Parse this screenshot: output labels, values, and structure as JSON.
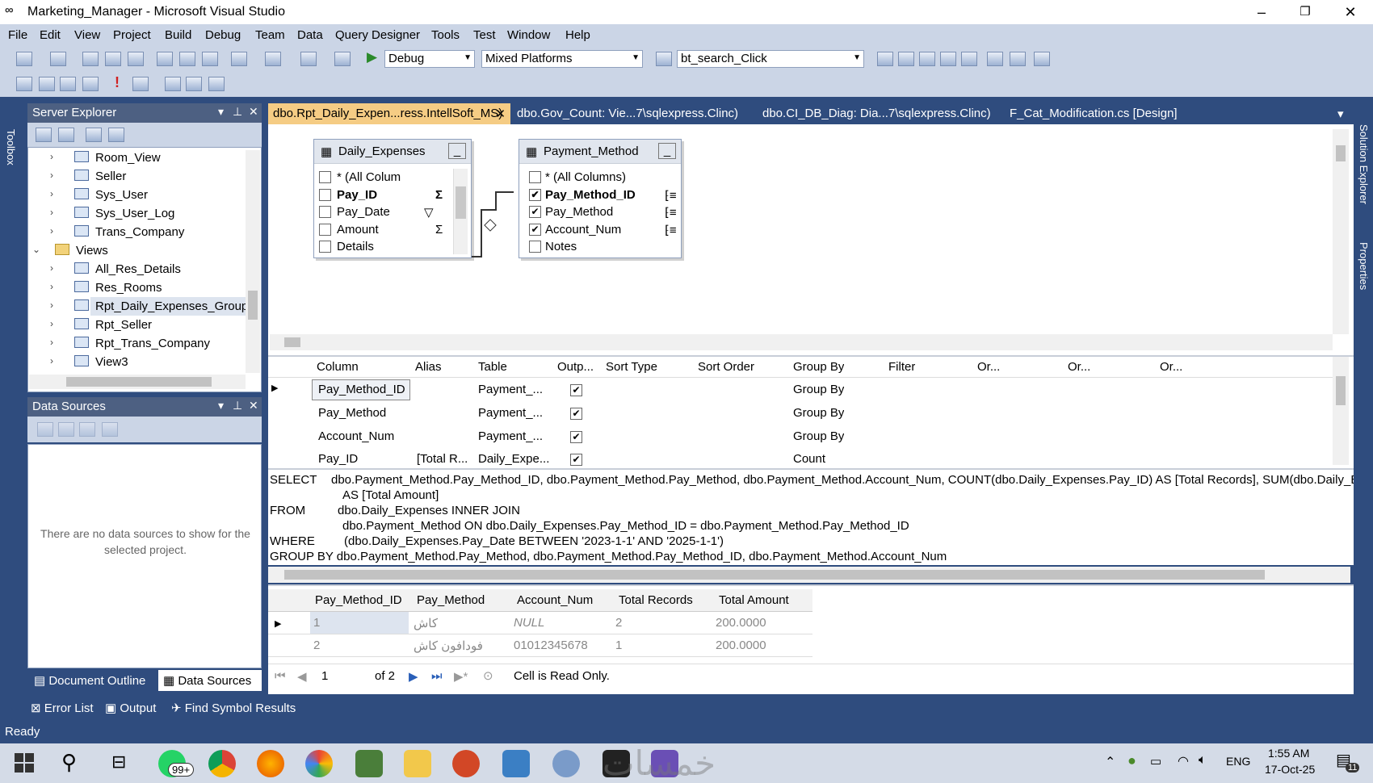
{
  "window": {
    "title": "Marketing_Manager - Microsoft Visual Studio"
  },
  "menu": [
    "File",
    "Edit",
    "View",
    "Project",
    "Build",
    "Debug",
    "Team",
    "Data",
    "Query Designer",
    "Tools",
    "Test",
    "Window",
    "Help"
  ],
  "toolbar": {
    "config": "Debug",
    "platform": "Mixed Platforms",
    "find": "bt_search_Click"
  },
  "left_strip": {
    "toolbox": "Toolbox"
  },
  "right_strip": {
    "solution_explorer": "Solution Explorer",
    "properties": "Properties"
  },
  "server_explorer": {
    "title": "Server Explorer",
    "items": [
      {
        "label": "Room_View",
        "kind": "table"
      },
      {
        "label": "Seller",
        "kind": "table"
      },
      {
        "label": "Sys_User",
        "kind": "table"
      },
      {
        "label": "Sys_User_Log",
        "kind": "table"
      },
      {
        "label": "Trans_Company",
        "kind": "table"
      },
      {
        "label": "Views",
        "kind": "folder"
      },
      {
        "label": "All_Res_Details",
        "kind": "view"
      },
      {
        "label": "Res_Rooms",
        "kind": "view"
      },
      {
        "label": "Rpt_Daily_Expenses_GroupB",
        "kind": "view"
      },
      {
        "label": "Rpt_Seller",
        "kind": "view"
      },
      {
        "label": "Rpt_Trans_Company",
        "kind": "view"
      },
      {
        "label": "View3",
        "kind": "view"
      }
    ]
  },
  "data_sources": {
    "title": "Data Sources",
    "empty_text": "There are no data sources to show for the selected project."
  },
  "bottom_left_tabs": {
    "outline": "Document Outline",
    "ds": "Data Sources"
  },
  "bottom_tabs": {
    "errors": "Error List",
    "output": "Output",
    "find": "Find Symbol Results"
  },
  "doc_tabs": [
    {
      "label": "dbo.Rpt_Daily_Expen...ress.IntellSoft_MS)",
      "active": true
    },
    {
      "label": "dbo.Gov_Count: Vie...7\\sqlexpress.Clinc)",
      "active": false
    },
    {
      "label": "dbo.CI_DB_Diag: Dia...7\\sqlexpress.Clinc)",
      "active": false
    },
    {
      "label": "F_Cat_Modification.cs [Design]",
      "active": false
    }
  ],
  "diagram": {
    "table1": {
      "title": "Daily_Expenses",
      "rows": [
        "* (All Colum",
        "Pay_ID",
        "Pay_Date",
        "Amount",
        "Details"
      ]
    },
    "table2": {
      "title": "Payment_Method",
      "rows": [
        "* (All Columns)",
        "Pay_Method_ID",
        "Pay_Method",
        "Account_Num",
        "Notes"
      ]
    }
  },
  "criteria": {
    "headers": [
      "Column",
      "Alias",
      "Table",
      "Outp...",
      "Sort Type",
      "Sort Order",
      "Group By",
      "Filter",
      "Or...",
      "Or...",
      "Or..."
    ],
    "rows": [
      {
        "column": "Pay_Method_ID",
        "alias": "",
        "table": "Payment_...",
        "group": "Group By"
      },
      {
        "column": "Pay_Method",
        "alias": "",
        "table": "Payment_...",
        "group": "Group By"
      },
      {
        "column": "Account_Num",
        "alias": "",
        "table": "Payment_...",
        "group": "Group By"
      },
      {
        "column": "Pay_ID",
        "alias": "[Total R...",
        "table": "Daily_Expe...",
        "group": "Count"
      }
    ]
  },
  "sql": {
    "l1k": "SELECT",
    "l1": "dbo.Payment_Method.Pay_Method_ID, dbo.Payment_Method.Pay_Method, dbo.Payment_Method.Account_Num, COUNT(dbo.Daily_Expenses.Pay_ID) AS [Total Records], SUM(dbo.Daily_Expe",
    "l2": "AS [Total Amount]",
    "l3k": "FROM",
    "l3": "dbo.Daily_Expenses INNER JOIN",
    "l4": "dbo.Payment_Method ON dbo.Daily_Expenses.Pay_Method_ID = dbo.Payment_Method.Pay_Method_ID",
    "l5k": "WHERE",
    "l5": "(dbo.Daily_Expenses.Pay_Date BETWEEN '2023-1-1' AND '2025-1-1')",
    "l6": "GROUP BY dbo.Payment_Method.Pay_Method, dbo.Payment_Method.Pay_Method_ID, dbo.Payment_Method.Account_Num"
  },
  "results": {
    "headers": [
      "Pay_Method_ID",
      "Pay_Method",
      "Account_Num",
      "Total Records",
      "Total Amount"
    ],
    "rows": [
      [
        "1",
        "كاش",
        "NULL",
        "2",
        "200.0000"
      ],
      [
        "2",
        "فودافون كاش",
        "01012345678",
        "1",
        "200.0000"
      ]
    ]
  },
  "nav": {
    "current": "1",
    "of": "of 2",
    "status": "Cell is Read Only."
  },
  "statusbar": {
    "text": "Ready"
  },
  "taskbar": {
    "badge": "99+",
    "lang": "ENG",
    "time": "1:55 AM",
    "date": "17-Oct-25",
    "notif": "11",
    "watermark": "خمسات"
  }
}
